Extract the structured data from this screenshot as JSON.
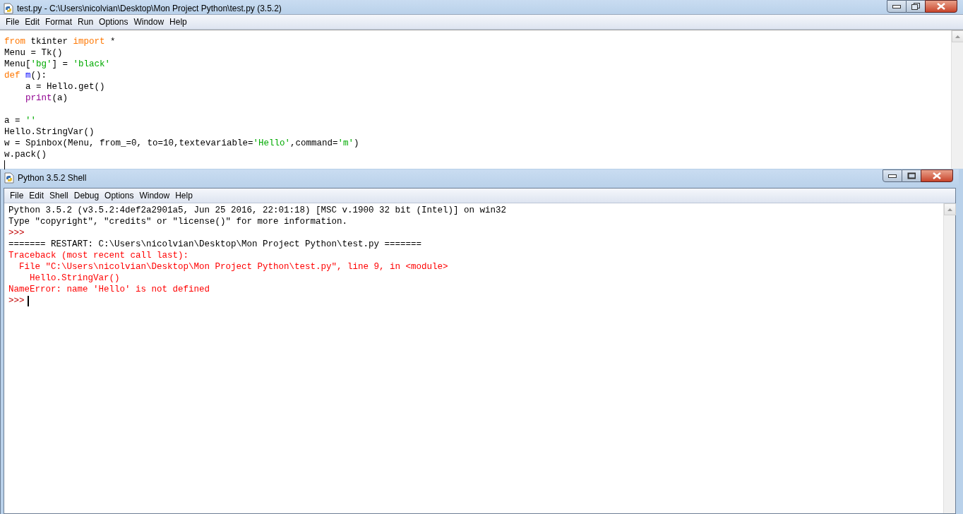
{
  "editor": {
    "title": "test.py - C:\\Users\\nicolvian\\Desktop\\Mon Project Python\\test.py (3.5.2)",
    "menu": [
      "File",
      "Edit",
      "Format",
      "Run",
      "Options",
      "Window",
      "Help"
    ],
    "code_lines": [
      [
        {
          "kind": "keyword",
          "text": "from"
        },
        {
          "kind": "plain",
          "text": " tkinter "
        },
        {
          "kind": "keyword",
          "text": "import"
        },
        {
          "kind": "plain",
          "text": " *"
        }
      ],
      [
        {
          "kind": "plain",
          "text": "Menu = Tk()"
        }
      ],
      [
        {
          "kind": "plain",
          "text": "Menu["
        },
        {
          "kind": "string",
          "text": "'bg'"
        },
        {
          "kind": "plain",
          "text": "] = "
        },
        {
          "kind": "string",
          "text": "'black'"
        }
      ],
      [
        {
          "kind": "keyword",
          "text": "def"
        },
        {
          "kind": "defname",
          "text": " m"
        },
        {
          "kind": "plain",
          "text": "():"
        }
      ],
      [
        {
          "kind": "plain",
          "text": "    a = Hello.get()"
        }
      ],
      [
        {
          "kind": "builtin",
          "text": "    print"
        },
        {
          "kind": "plain",
          "text": "(a)"
        }
      ],
      [
        {
          "kind": "blank"
        }
      ],
      [
        {
          "kind": "plain",
          "text": "a = "
        },
        {
          "kind": "string",
          "text": "''"
        }
      ],
      [
        {
          "kind": "plain",
          "text": "Hello.StringVar()"
        }
      ],
      [
        {
          "kind": "plain",
          "text": "w = Spinbox(Menu, from_=0, to=10,textevariable="
        },
        {
          "kind": "string",
          "text": "'Hello'"
        },
        {
          "kind": "plain",
          "text": ",command="
        },
        {
          "kind": "string",
          "text": "'m'"
        },
        {
          "kind": "plain",
          "text": ")"
        }
      ],
      [
        {
          "kind": "plain",
          "text": "w.pack()"
        }
      ]
    ]
  },
  "shell": {
    "title": "Python 3.5.2 Shell",
    "menu": [
      "File",
      "Edit",
      "Shell",
      "Debug",
      "Options",
      "Window",
      "Help"
    ],
    "lines": [
      {
        "kind": "output",
        "text": "Python 3.5.2 (v3.5.2:4def2a2901a5, Jun 25 2016, 22:01:18) [MSC v.1900 32 bit (Intel)] on win32"
      },
      {
        "kind": "output",
        "text": "Type \"copyright\", \"credits\" or \"license()\" for more information."
      },
      {
        "kind": "prompt",
        "text": ">>>"
      },
      {
        "kind": "output",
        "text": "======= RESTART: C:\\Users\\nicolvian\\Desktop\\Mon Project Python\\test.py ======="
      },
      {
        "kind": "error",
        "text": "Traceback (most recent call last):"
      },
      {
        "kind": "error",
        "text": "  File \"C:\\Users\\nicolvian\\Desktop\\Mon Project Python\\test.py\", line 9, in <module>"
      },
      {
        "kind": "error",
        "text": "    Hello.StringVar()"
      },
      {
        "kind": "error",
        "text": "NameError: name 'Hello' is not defined"
      }
    ],
    "input_prompt": ">>>"
  }
}
